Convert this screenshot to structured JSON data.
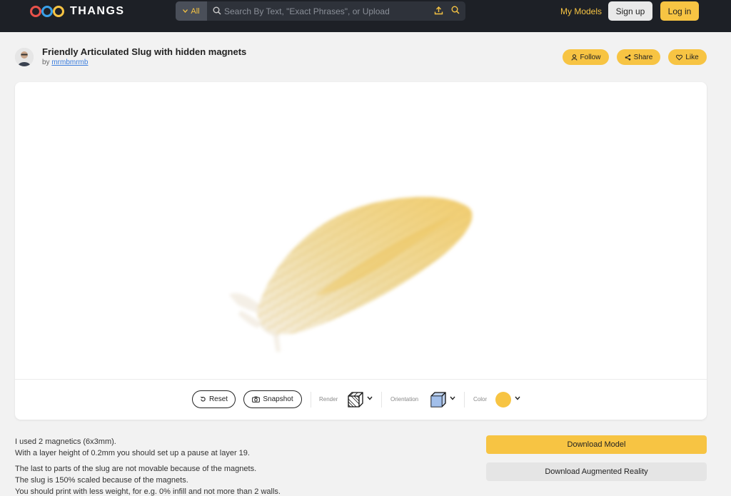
{
  "nav": {
    "brand": "THANGS",
    "search_scope": "All",
    "search_placeholder": "Search By Text, \"Exact Phrases\", or Upload",
    "my_models": "My Models",
    "sign_up": "Sign up",
    "log_in": "Log in"
  },
  "model": {
    "title": "Friendly Articulated Slug with hidden magnets",
    "by_prefix": "by",
    "author": "mrmbmrmb"
  },
  "actions": {
    "follow": "Follow",
    "share": "Share",
    "like": "Like"
  },
  "viewer": {
    "reset": "Reset",
    "snapshot": "Snapshot",
    "render_label": "Render",
    "orientation_label": "Orientation",
    "color_label": "Color",
    "color_value": "#f7c443"
  },
  "description": [
    [
      "I used 2 magnetics (6x3mm).",
      "With a layer height of 0.2mm you should set up a pause at layer 19."
    ],
    [
      "The last to parts of the slug are not movable because of the magnets.",
      "The slug is 150% scaled because of the magnets.",
      "You should print with less weight, for e.g. 0% infill and not more than 2 walls."
    ]
  ],
  "downloads": {
    "model": "Download Model",
    "ar": "Download Augmented Reality"
  },
  "colors": {
    "accent": "#f7c443",
    "nav_bg": "#1d2026",
    "link": "#3b7ddd"
  }
}
